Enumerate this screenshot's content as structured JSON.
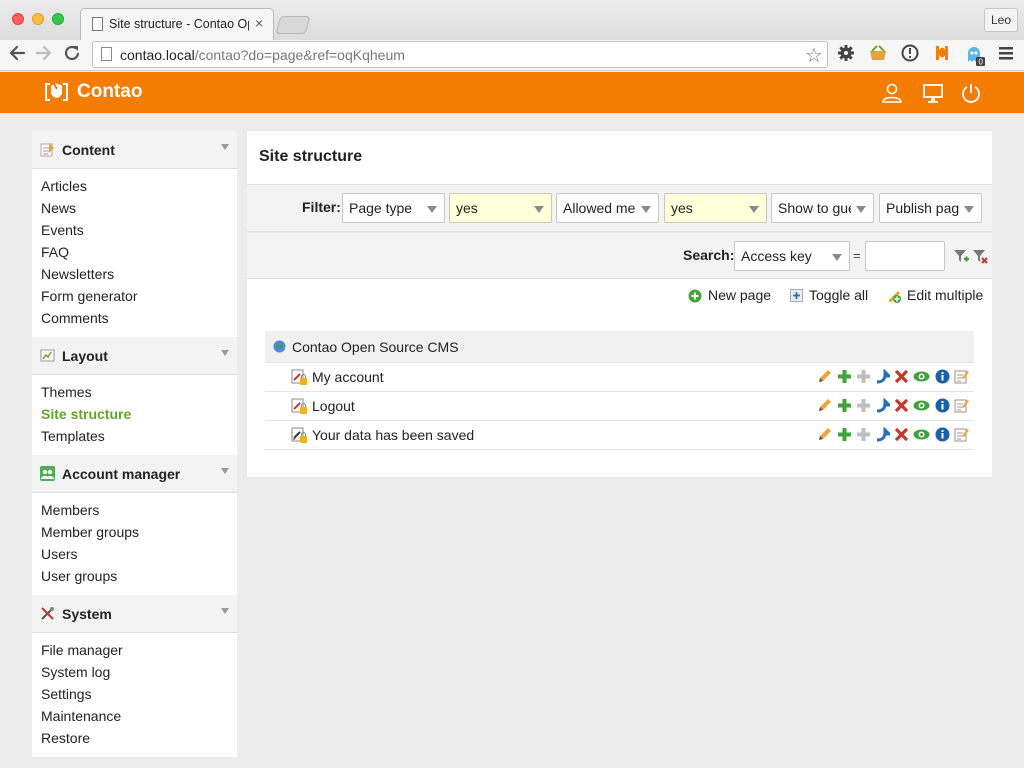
{
  "browser": {
    "tab_title": "Site structure - Contao Opе",
    "tab_close": "×",
    "user": "Leo",
    "url_host": "contao.local",
    "url_rest": "/contao?do=page&ref=oqKqheum",
    "star": "☆"
  },
  "header": {
    "logo_text": "Contao"
  },
  "sidebar": {
    "groups": [
      {
        "title": "Content",
        "icon": "notepad-icon",
        "items": [
          {
            "label": "Articles"
          },
          {
            "label": "News"
          },
          {
            "label": "Events"
          },
          {
            "label": "FAQ"
          },
          {
            "label": "Newsletters"
          },
          {
            "label": "Form generator"
          },
          {
            "label": "Comments"
          }
        ]
      },
      {
        "title": "Layout",
        "icon": "layout-icon",
        "items": [
          {
            "label": "Themes"
          },
          {
            "label": "Site structure",
            "active": true
          },
          {
            "label": "Templates"
          }
        ]
      },
      {
        "title": "Account manager",
        "icon": "users-icon",
        "items": [
          {
            "label": "Members"
          },
          {
            "label": "Member groups"
          },
          {
            "label": "Users"
          },
          {
            "label": "User groups"
          }
        ]
      },
      {
        "title": "System",
        "icon": "tools-icon",
        "items": [
          {
            "label": "File manager"
          },
          {
            "label": "System log"
          },
          {
            "label": "Settings"
          },
          {
            "label": "Maintenance"
          },
          {
            "label": "Restore"
          }
        ]
      }
    ]
  },
  "main": {
    "title": "Site structure",
    "filter": {
      "label": "Filter:",
      "selects": [
        "Page type",
        "yes",
        "Allowed mer",
        "yes",
        "Show to gue",
        "Publish page"
      ]
    },
    "search": {
      "label": "Search:",
      "field": "Access key",
      "operator": "=",
      "value": ""
    },
    "actions": {
      "new_page": "New page",
      "toggle_all": "Toggle all",
      "edit_multiple": "Edit multiple"
    },
    "tree": {
      "root": "Contao Open Source CMS",
      "pages": [
        {
          "title": "My account"
        },
        {
          "title": "Logout"
        },
        {
          "title": "Your data has been saved"
        }
      ]
    }
  },
  "colors": {
    "brand": "#f47c00",
    "active_link": "#63a52b"
  }
}
